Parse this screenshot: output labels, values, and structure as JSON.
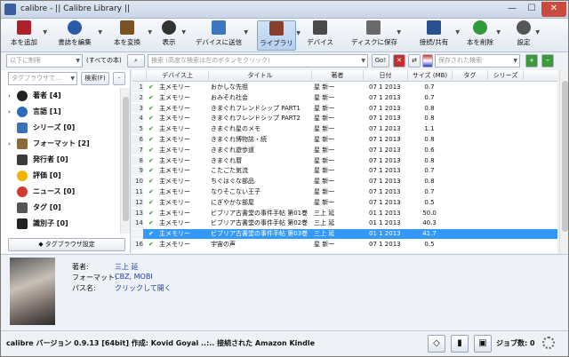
{
  "window": {
    "title": "calibre - || Calibre Library ||",
    "minimize": "—",
    "maximize": "☐",
    "close": "✕"
  },
  "toolbar": {
    "items": [
      {
        "label": "本を追加",
        "icon": "add-book-icon",
        "color": "#b0202a"
      },
      {
        "label": "書誌を編集",
        "icon": "edit-metadata-icon",
        "color": "#2b5aa6"
      },
      {
        "label": "本を変換",
        "icon": "convert-book-icon",
        "color": "#7a5320"
      },
      {
        "label": "表示",
        "icon": "view-icon",
        "color": "#333333"
      },
      {
        "label": "デバイスに送信",
        "icon": "send-to-device-icon",
        "color": "#3a78c4"
      },
      {
        "label": "ライブラリ",
        "icon": "library-icon",
        "color": "#8a3f2a"
      },
      {
        "label": "デバイス",
        "icon": "device-icon",
        "color": "#4a4a4a"
      },
      {
        "label": "ディスクに保存",
        "icon": "save-to-disk-icon",
        "color": "#6a6a6a"
      },
      {
        "label": "接続/共有",
        "icon": "connect-share-icon",
        "color": "#2a4f8f"
      },
      {
        "label": "本を削除",
        "icon": "remove-book-icon",
        "color": "#2f9b3a"
      },
      {
        "label": "設定",
        "icon": "preferences-icon",
        "color": "#555555"
      }
    ]
  },
  "search_row": {
    "prev_search_placeholder": "以下に制限",
    "all_books_label": "(すべての本)",
    "search_placeholder": "検索 (高度な検索は左のボタンをクリック)",
    "go_label": "Go!",
    "saved_search_placeholder": "保存された検索"
  },
  "tag_browser": {
    "find_placeholder": "タグブラウザで…",
    "find_button": "検索(F)",
    "collapse_button": "-",
    "items": [
      {
        "label": "著者 [4]",
        "icon": "author-icon",
        "color": "#222222",
        "expandable": true
      },
      {
        "label": "言語 [1]",
        "icon": "language-icon",
        "color": "#2a6bbd",
        "expandable": true
      },
      {
        "label": "シリーズ [0]",
        "icon": "series-icon",
        "color": "#3b6fb6",
        "expandable": false
      },
      {
        "label": "フォーマット [2]",
        "icon": "format-icon",
        "color": "#8a6a3a",
        "expandable": true
      },
      {
        "label": "発行者 [0]",
        "icon": "publisher-icon",
        "color": "#3a3a3a",
        "expandable": false
      },
      {
        "label": "評価 [0]",
        "icon": "rating-icon",
        "color": "#f2b400",
        "expandable": false
      },
      {
        "label": "ニュース [0]",
        "icon": "news-icon",
        "color": "#d23b2b",
        "expandable": false
      },
      {
        "label": "タグ [0]",
        "icon": "tag-icon",
        "color": "#555555",
        "expandable": false
      },
      {
        "label": "識別子 [0]",
        "icon": "identifier-icon",
        "color": "#222222",
        "expandable": false
      }
    ],
    "configure_label": "タグブラウザ設定"
  },
  "book_list": {
    "columns": [
      "デバイス上",
      "タイトル",
      "著者",
      "日付",
      "サイズ (MB)",
      "タグ",
      "シリーズ"
    ],
    "selected_row": 15,
    "rows": [
      {
        "n": "1",
        "device": "主メモリー",
        "title": "おかしな先祖",
        "author": "星 新一",
        "date": "07 1 2013",
        "size": "0.7"
      },
      {
        "n": "2",
        "device": "主メモリー",
        "title": "おみそれ社会",
        "author": "星 新一",
        "date": "07 1 2013",
        "size": "0.7"
      },
      {
        "n": "3",
        "device": "主メモリー",
        "title": "きまぐれフレンドシップ PART1",
        "author": "星 新一",
        "date": "07 1 2013",
        "size": "0.8"
      },
      {
        "n": "4",
        "device": "主メモリー",
        "title": "きまぐれフレンドシップ PART2",
        "author": "星 新一",
        "date": "07 1 2013",
        "size": "0.8"
      },
      {
        "n": "5",
        "device": "主メモリー",
        "title": "きまぐれ星のメモ",
        "author": "星 新一",
        "date": "07 1 2013",
        "size": "1.1"
      },
      {
        "n": "6",
        "device": "主メモリー",
        "title": "きまぐれ博物誌・続",
        "author": "星 新一",
        "date": "07 1 2013",
        "size": "0.8"
      },
      {
        "n": "7",
        "device": "主メモリー",
        "title": "きまぐれ遊歩道",
        "author": "星 新一",
        "date": "07 1 2013",
        "size": "0.6"
      },
      {
        "n": "8",
        "device": "主メモリー",
        "title": "きまぐれ暦",
        "author": "星 新一",
        "date": "07 1 2013",
        "size": "0.8"
      },
      {
        "n": "9",
        "device": "主メモリー",
        "title": "こたごた気流",
        "author": "星 新一",
        "date": "07 1 2013",
        "size": "0.7"
      },
      {
        "n": "10",
        "device": "主メモリー",
        "title": "ちぐはぐな部品",
        "author": "星 新一",
        "date": "07 1 2013",
        "size": "0.8"
      },
      {
        "n": "11",
        "device": "主メモリー",
        "title": "なりそこない王子",
        "author": "星 新一",
        "date": "07 1 2013",
        "size": "0.7"
      },
      {
        "n": "12",
        "device": "主メモリー",
        "title": "にぎやかな部屋",
        "author": "星 新一",
        "date": "07 1 2013",
        "size": "0.5"
      },
      {
        "n": "13",
        "device": "主メモリー",
        "title": "ビブリア古書堂の事件手帖 第01巻",
        "author": "三上 延",
        "date": "01 1 2013",
        "size": "50.0"
      },
      {
        "n": "14",
        "device": "主メモリー",
        "title": "ビブリア古書堂の事件手帖 第02巻",
        "author": "三上 延",
        "date": "01 1 2013",
        "size": "40.3"
      },
      {
        "n": "15",
        "device": "主メモリー",
        "title": "ビブリア古書堂の事件手帖 第03巻",
        "author": "三上 延",
        "date": "01 1 2013",
        "size": "41.7"
      },
      {
        "n": "16",
        "device": "主メモリー",
        "title": "宇宙の声",
        "author": "星 新一",
        "date": "07 1 2013",
        "size": "0.5"
      }
    ]
  },
  "details": {
    "author_label": "著者:",
    "author_value": "三上 延",
    "format_label": "フォーマット:",
    "format_value": "CBZ, MOBI",
    "path_label": "パス名:",
    "path_value": "クリックして開く"
  },
  "status": {
    "text": "calibre バージョン 0.9.13 [64bit] 作成: Kovid Goyal ..:.. 接続された Amazon Kindle",
    "jobs_label": "ジョブ数: 0"
  }
}
